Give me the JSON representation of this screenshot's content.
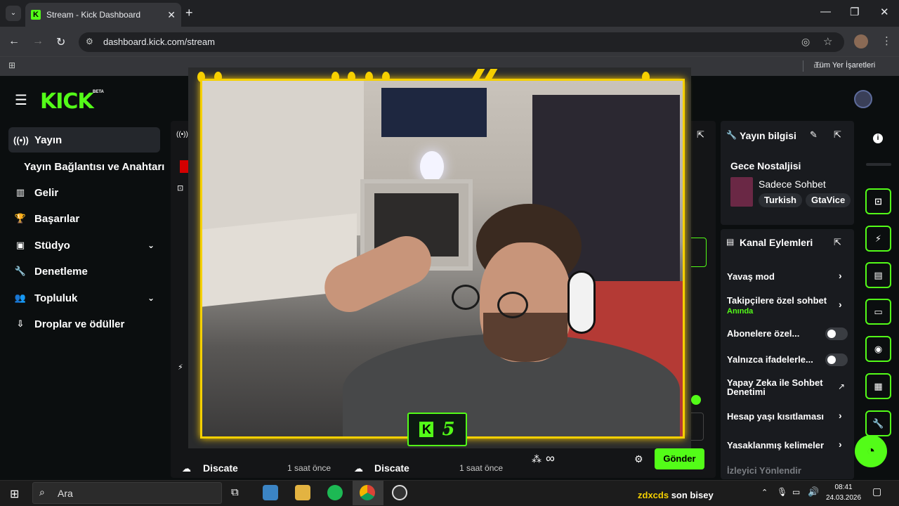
{
  "browser": {
    "tab_title": "Stream - Kick Dashboard",
    "tab_close": "✕",
    "new_tab": "+",
    "url": "dashboard.kick.com/stream",
    "bookmarks_label": "Tüm Yer İşaretleri",
    "window_controls": {
      "minimize": "—",
      "maximize": "❐",
      "close": "✕"
    }
  },
  "dashboard": {
    "logo": "KICK",
    "logo_badge": "BETA",
    "nav": [
      {
        "label": "Yayın",
        "icon": "broadcast-icon",
        "glyph": "((•))",
        "active": true
      },
      {
        "label": "Gelir",
        "icon": "chart-icon",
        "glyph": "▥"
      },
      {
        "label": "Başarılar",
        "icon": "trophy-icon",
        "glyph": "🏆"
      },
      {
        "label": "Stüdyo",
        "icon": "studio-icon",
        "glyph": "▣",
        "expandable": true
      },
      {
        "label": "Denetleme",
        "icon": "wrench-icon",
        "glyph": "🔧"
      },
      {
        "label": "Topluluk",
        "icon": "community-icon",
        "glyph": "👥",
        "expandable": true
      },
      {
        "label": "Droplar ve ödüller",
        "icon": "drops-icon",
        "glyph": "⇩"
      }
    ],
    "nav_sub_item": "Yayın Bağlantısı ve Anahtarı",
    "stream_info": {
      "title": "Yayın bilgisi",
      "stream_title": "Gece Nostaljisi",
      "category": "Sadece Sohbet",
      "tags": [
        "Turkish",
        "GtaVice"
      ]
    },
    "channel_actions": {
      "title": "Kanal Eylemleri",
      "rows": [
        {
          "label": "Yavaş mod",
          "control": "chevron"
        },
        {
          "label": "Takipçilere özel sohbet",
          "sublabel": "Anında",
          "control": "chevron"
        },
        {
          "label": "Abonelere özel...",
          "control": "toggle"
        },
        {
          "label": "Yalnızca ifadelerle...",
          "control": "toggle"
        },
        {
          "label": "Yapay Zeka ile Sohbet Denetimi",
          "control": "external"
        },
        {
          "label": "Hesap yaşı kısıtlaması",
          "control": "chevron"
        },
        {
          "label": "Yasaklanmış kelimeler",
          "control": "chevron"
        },
        {
          "label": "İzleyici Yönlendir",
          "control": "none"
        }
      ]
    },
    "feed": [
      {
        "name": "Discate",
        "time": "1 saat önce"
      },
      {
        "name": "Discate",
        "time": "1 saat önce"
      }
    ],
    "send_button": "Gönder",
    "infinity": "∞"
  },
  "webcam": {
    "badge_letter": "K",
    "badge_number": "5"
  },
  "taskbar": {
    "search_placeholder": "Ara",
    "ticker_user": "zdxcds",
    "ticker_message": "son bisey",
    "time": "08:41",
    "date": "24.03.2026"
  },
  "colors": {
    "brand": "#53fc18",
    "overlay_yellow": "#f5d000"
  }
}
